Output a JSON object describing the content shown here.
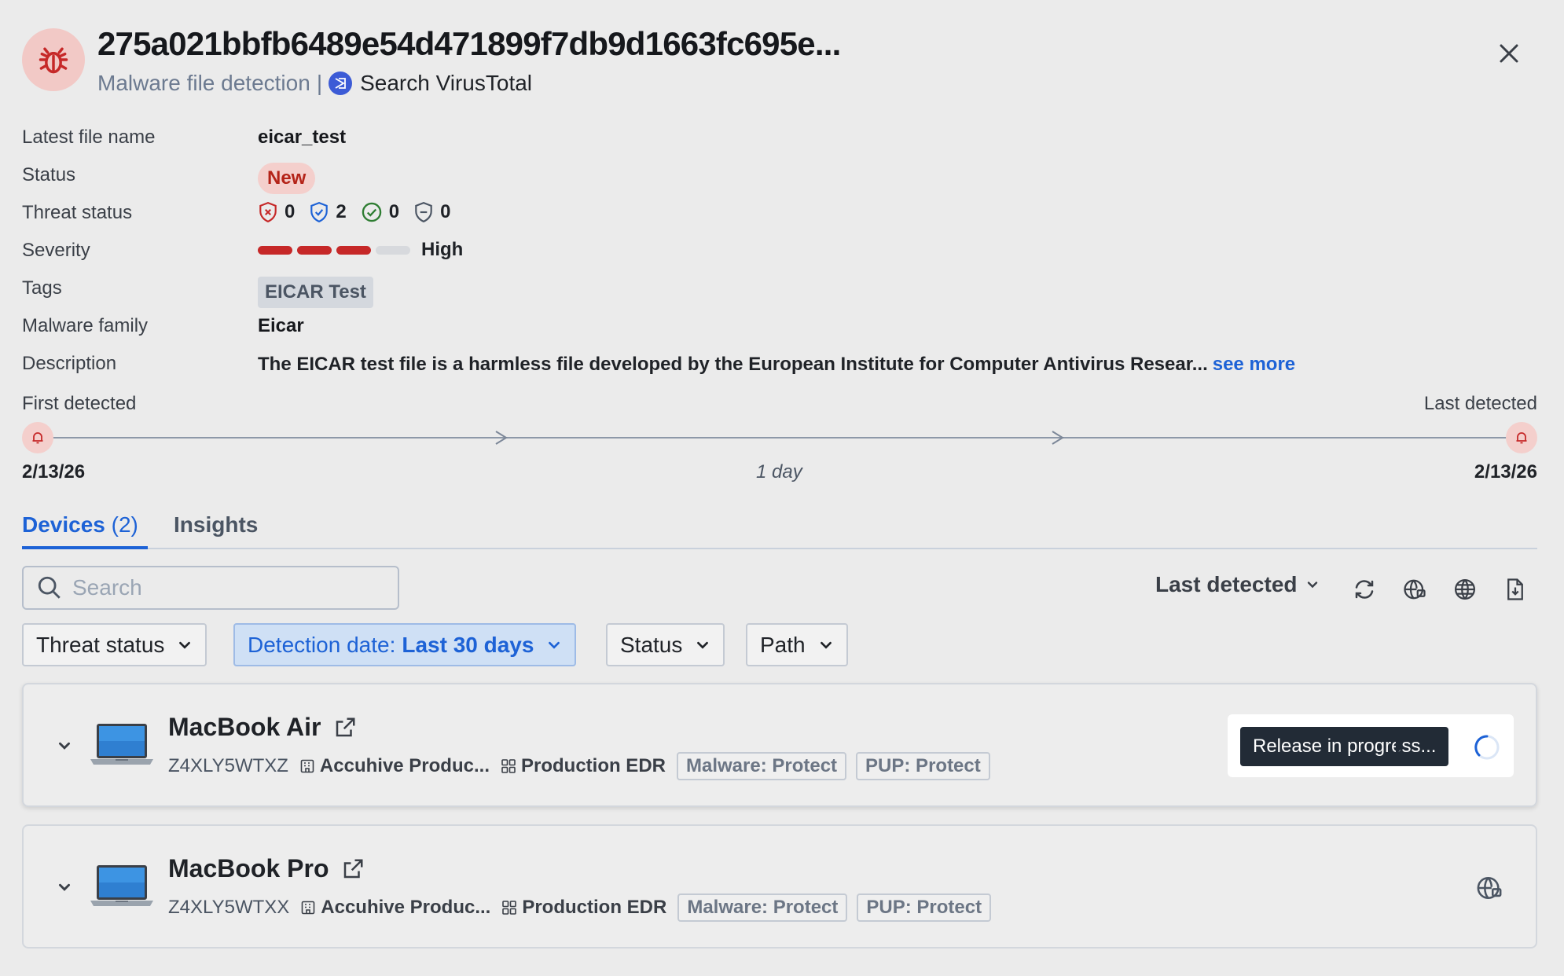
{
  "header": {
    "title": "275a021bbfb6489e54d471899f7db9d1663fc695e...",
    "subtitle": "Malware file detection",
    "separator": "|",
    "virustotal_link": "Search VirusTotal",
    "avatar_icon": "bug-icon",
    "close_icon": "close-icon"
  },
  "details": {
    "latest_file_name_label": "Latest file name",
    "latest_file_name": "eicar_test",
    "status_label": "Status",
    "status": "New",
    "threat_status_label": "Threat status",
    "threat_counts": {
      "malicious": "0",
      "protected": "2",
      "resolved": "0",
      "other": "0"
    },
    "severity_label": "Severity",
    "severity_level": 3,
    "severity_max": 4,
    "severity": "High",
    "tags_label": "Tags",
    "tag": "EICAR Test",
    "malware_family_label": "Malware family",
    "malware_family": "Eicar",
    "description_label": "Description",
    "description": "The EICAR test file is a harmless file developed by the European Institute for Computer Antivirus Resear...",
    "see_more": "see more"
  },
  "timeline": {
    "first_label": "First detected",
    "last_label": "Last detected",
    "first_date": "2/13/26",
    "last_date": "2/13/26",
    "duration": "1 day"
  },
  "tabs": {
    "devices_label": "Devices",
    "devices_count": "(2)",
    "insights_label": "Insights"
  },
  "toolbar": {
    "search_placeholder": "Search",
    "sort_label": "Last detected",
    "icons": [
      "refresh-icon",
      "globe-network-icon",
      "globe-icon",
      "download-report-icon"
    ]
  },
  "filters": {
    "threat_status": "Threat status",
    "detection_date_prefix": "Detection date:",
    "detection_date_value": "Last 30 days",
    "status": "Status",
    "path": "Path"
  },
  "devices": [
    {
      "name": "MacBook Air",
      "serial": "Z4XLY5WTXZ",
      "org": "Accuhive Produc...",
      "plan": "Production EDR",
      "malware_policy": "Malware: Protect",
      "pup_policy": "PUP: Protect",
      "tooltip": "Release in progress..."
    },
    {
      "name": "MacBook Pro",
      "serial": "Z4XLY5WTXX",
      "org": "Accuhive Produc...",
      "plan": "Production EDR",
      "malware_policy": "Malware: Protect",
      "pup_policy": "PUP: Protect"
    }
  ],
  "colors": {
    "accent": "#1d62d6",
    "danger": "#c62828",
    "background": "#ebebeb"
  }
}
